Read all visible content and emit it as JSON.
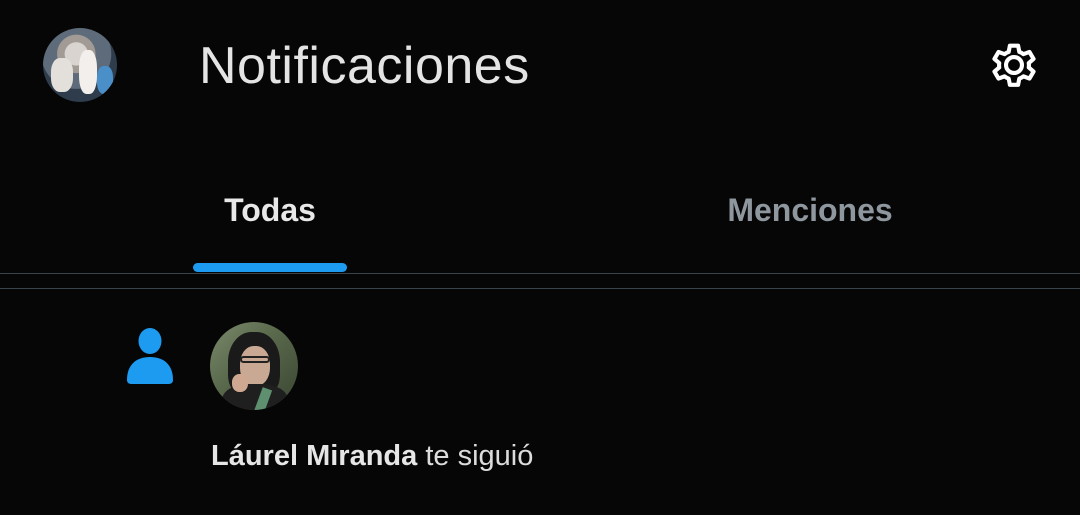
{
  "header": {
    "title": "Notificaciones",
    "settings_icon": "gear-icon",
    "avatar_icon": "profile-avatar"
  },
  "tabs": [
    {
      "label": "Todas",
      "active": true
    },
    {
      "label": "Menciones",
      "active": false
    }
  ],
  "colors": {
    "background": "#060606",
    "accent": "#1d9bf0",
    "divider": "#38444d",
    "text_primary": "#e4e4e4",
    "text_secondary": "#8e969e"
  },
  "notifications": [
    {
      "type_icon": "person-follow-icon",
      "user_name": "Láurel Miranda",
      "action": " te siguió"
    }
  ]
}
